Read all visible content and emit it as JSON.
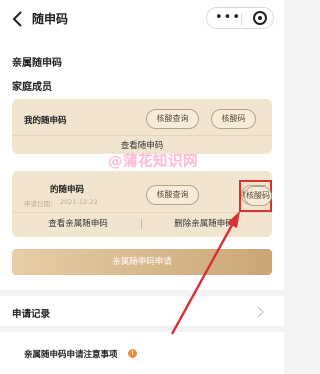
{
  "nav": {
    "title": "随申码",
    "more_glyph": "•••"
  },
  "page": {
    "section_title": "亲属随申码",
    "family_label": "家庭成员",
    "card1": {
      "name": "我的随申码",
      "btn_test_query": "核酸查询",
      "btn_code": "核酸码",
      "view_link": "查看随申码"
    },
    "card2": {
      "name": "的随申码",
      "date_label": "申请日期：",
      "date_value": "2021-12-22",
      "btn_test_query": "核酸查询",
      "btn_code": "核酸码",
      "view_link": "查看亲属随申码",
      "delete_link": "删除亲属随申码"
    },
    "apply_button": "亲属随申码申请",
    "records_label": "申请记录",
    "notice_label": "亲属随申码申请注意事项",
    "notice_glyph": "!"
  },
  "watermark": "@蒲花知识网",
  "colors": {
    "card_bg": "#f2e5cf",
    "gold_start": "#e8cda6",
    "gold_end": "#c9a676",
    "highlight": "#d93036",
    "watermark": "#ffa0c8"
  }
}
